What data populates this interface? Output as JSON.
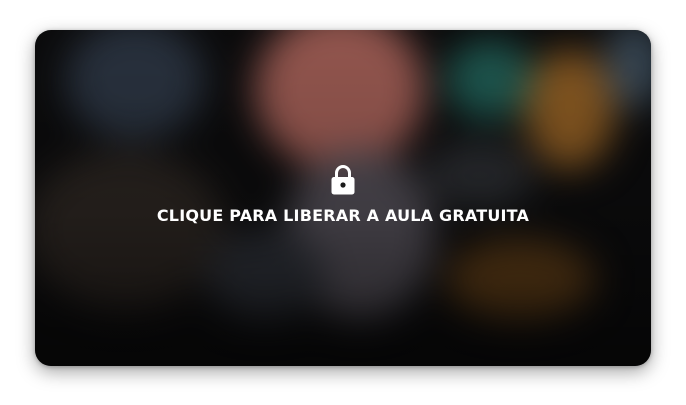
{
  "overlay": {
    "lock_icon": "lock-icon",
    "cta_text": "CLIQUE PARA LIBERAR A AULA GRATUITA",
    "text_color": "#ffffff"
  }
}
